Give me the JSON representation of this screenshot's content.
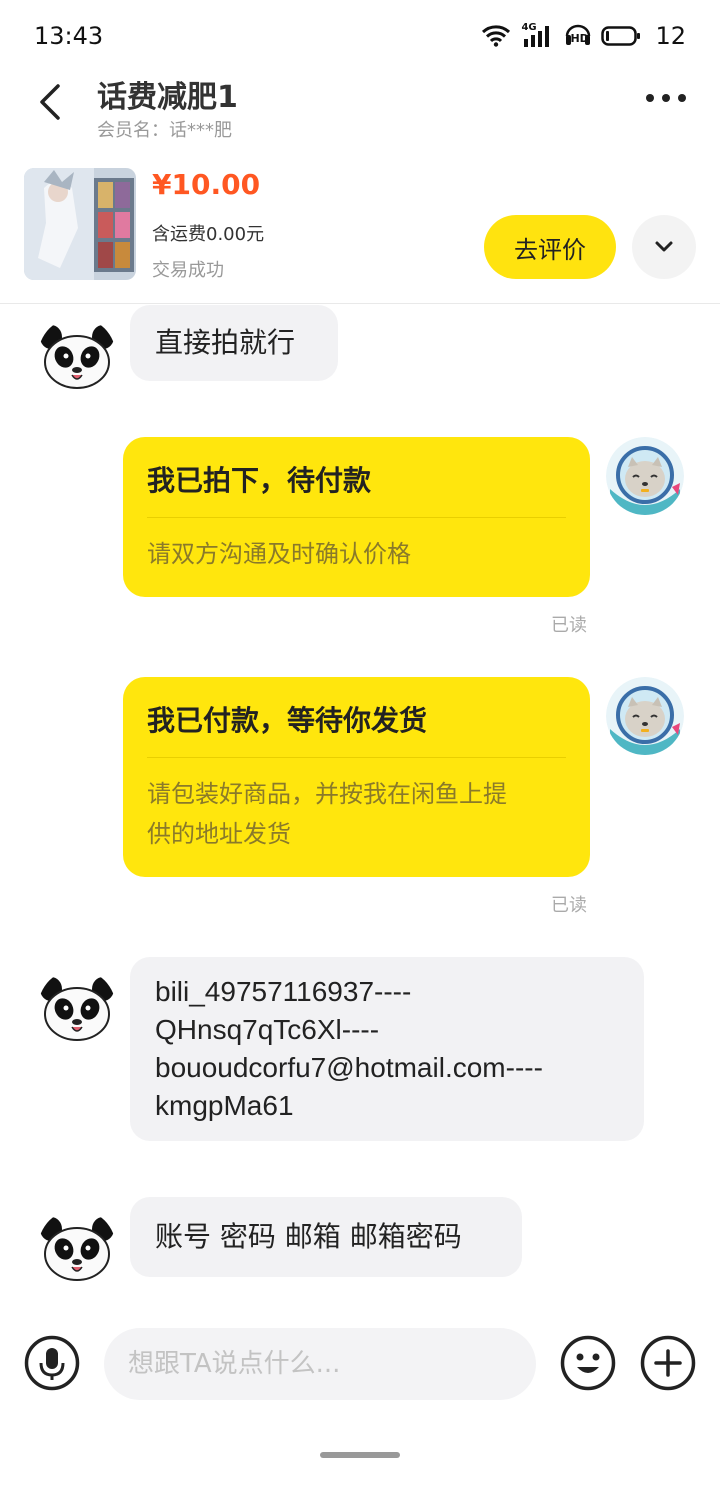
{
  "status_bar": {
    "time": "13:43",
    "network": "4G",
    "hd": "HD",
    "battery": "12"
  },
  "header": {
    "title": "话费减肥1",
    "member": "会员名：话***肥"
  },
  "product": {
    "price": "¥10.00",
    "shipping": "含运费0.00元",
    "status": "交易成功",
    "review_button": "去评价"
  },
  "messages": {
    "m1": "直接拍就行",
    "c1_title": "我已拍下，待付款",
    "c1_desc": "请双方沟通及时确认价格",
    "c1_read": "已读",
    "c2_title": "我已付款，等待你发货",
    "c2_desc_line1": "请包装好商品，并按我在闲鱼上提",
    "c2_desc_line2": "供的地址发货",
    "c2_read": "已读",
    "m2_line1": "bili_49757116937----",
    "m2_line2": "QHnsq7qTc6Xl----",
    "m2_line3": "bououdcorfu7@hotmail.com----",
    "m2_line4": "kmgpMa61",
    "m3": "账号 密码 邮箱 邮箱密码"
  },
  "input": {
    "placeholder": "想跟TA说点什么..."
  },
  "colors": {
    "accent_yellow": "#ffe60d",
    "price_orange": "#ff5722"
  }
}
